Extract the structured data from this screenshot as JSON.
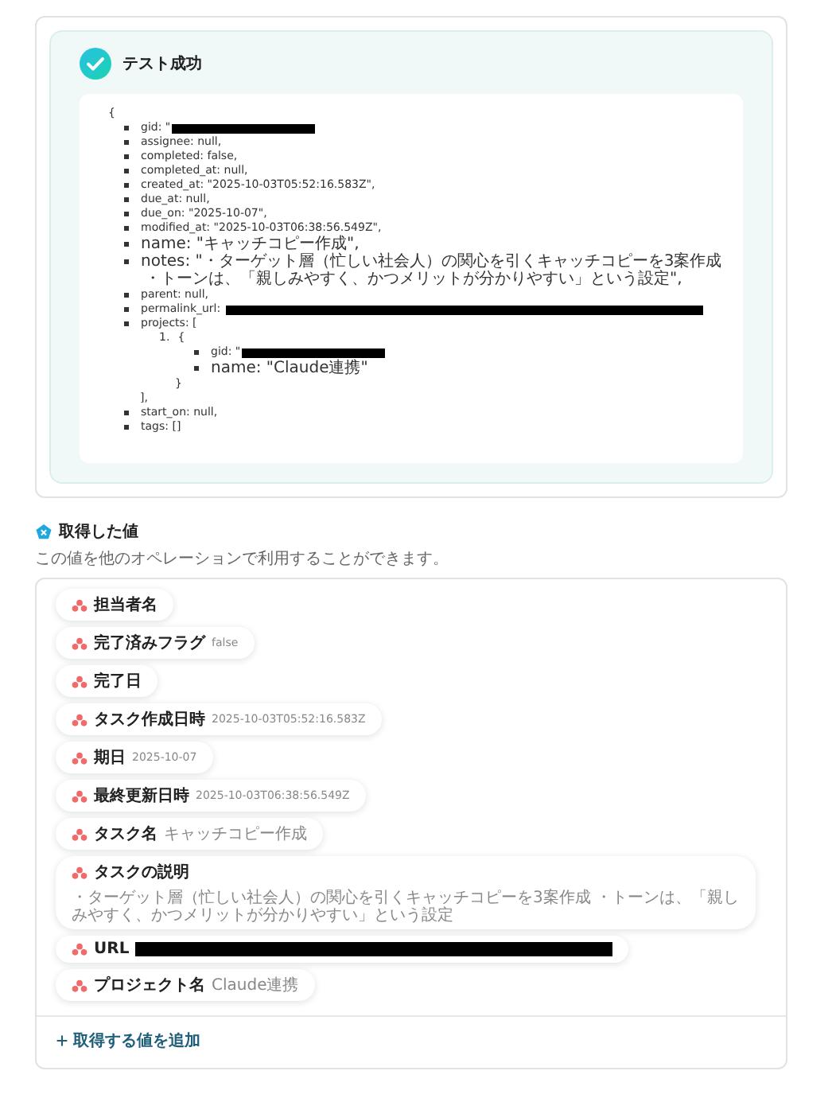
{
  "test_result": {
    "title": "テスト成功",
    "success": true,
    "code": {
      "open": "{",
      "items": [
        {
          "text": "gid: \"",
          "redacted": true
        },
        {
          "text": "assignee: null,"
        },
        {
          "text": "completed: false,"
        },
        {
          "text": "completed_at: null,"
        },
        {
          "text": "created_at: \"2025-10-03T05:52:16.583Z\","
        },
        {
          "text": "due_at: null,"
        },
        {
          "text": "due_on: \"2025-10-07\","
        },
        {
          "text": "modified_at: \"2025-10-03T06:38:56.549Z\","
        },
        {
          "text": "name: \"キャッチコピー作成\","
        },
        {
          "text": "notes: \"・ターゲット層（忙しい社会人）の関心を引くキャッチコピーを3案作成",
          "continuation": "・トーンは、「親しみやすく、かつメリットが分かりやすい」という設定\","
        },
        {
          "text": "parent: null,"
        },
        {
          "text": "permalink_url: ",
          "redacted": true
        },
        {
          "text": "projects: [",
          "closing": "],",
          "children": [
            {
              "marker": "1.",
              "text": "{",
              "closing": "}",
              "children": [
                {
                  "text": "gid: \"",
                  "redacted": true
                },
                {
                  "text": "name: \"Claude連携\""
                }
              ]
            }
          ]
        },
        {
          "text": "start_on: null,"
        },
        {
          "text": "tags: []"
        }
      ]
    }
  },
  "values_section": {
    "title": "取得した値",
    "description": "この値を他のオペレーションで利用することができます。",
    "fields": [
      {
        "label": "担当者名"
      },
      {
        "label": "完了済みフラグ",
        "value": "false"
      },
      {
        "label": "完了日"
      },
      {
        "label": "タスク作成日時",
        "value": "2025-10-03T05:52:16.583Z"
      },
      {
        "label": "期日",
        "value": "2025-10-07"
      },
      {
        "label": "最終更新日時",
        "value": "2025-10-03T06:38:56.549Z"
      },
      {
        "label": "タスク名",
        "value": "キャッチコピー作成"
      },
      {
        "label": "タスクの説明",
        "value": "・ターゲット層（忙しい社会人）の関心を引くキャッチコピーを3案作成 ・トーンは、「親しみやすく、かつメリットが分かりやすい」という設定"
      },
      {
        "label": "URL",
        "redacted": true
      },
      {
        "label": "プロジェクト名",
        "value": "Claude連携"
      }
    ],
    "add_button": "取得する値を追加"
  }
}
